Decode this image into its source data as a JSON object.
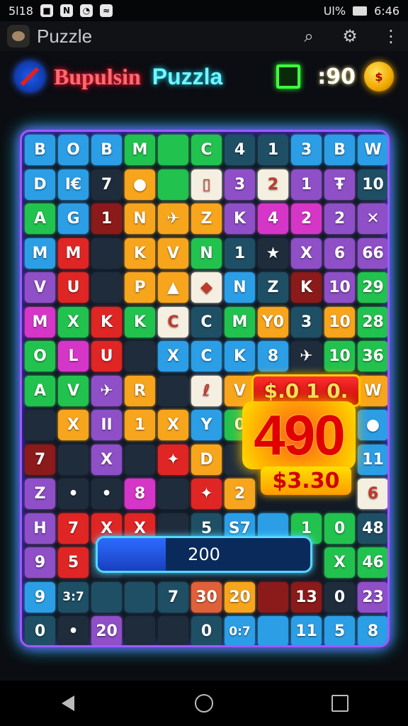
{
  "status_bar": {
    "left_text": "5l18",
    "left_icons": [
      "app-notification-icon",
      "n-notification-icon",
      "whatsapp-icon",
      "wifi-icon"
    ],
    "battery_label": "Ul%",
    "time": "6:46"
  },
  "app_bar": {
    "title": "Puzzle",
    "actions": [
      "search-icon",
      "settings-gear-icon",
      "more-vert-icon"
    ]
  },
  "game_header": {
    "title_part1": "Bupulsin",
    "title_part2": "Puzzla",
    "score": ":90",
    "colors": {
      "title1": "#ff6b6b",
      "title2": "#6ff7ff",
      "score_box": "#3dff3d"
    }
  },
  "board": {
    "tiles": [
      {
        "r": 0,
        "c": 0,
        "text": "B",
        "color": "#2b9ee6"
      },
      {
        "r": 0,
        "c": 1,
        "text": "O",
        "color": "#2b9ee6"
      },
      {
        "r": 0,
        "c": 2,
        "text": "B",
        "color": "#2b9ee6"
      },
      {
        "r": 0,
        "c": 3,
        "text": "M",
        "color": "#22c24e"
      },
      {
        "r": 0,
        "c": 4,
        "text": "",
        "color": "#22c24e"
      },
      {
        "r": 0,
        "c": 5,
        "text": "C",
        "color": "#22c24e"
      },
      {
        "r": 0,
        "c": 6,
        "text": "4",
        "color": "#1f4f64"
      },
      {
        "r": 0,
        "c": 7,
        "text": "1",
        "color": "#1f4f64"
      },
      {
        "r": 0,
        "c": 8,
        "text": "3",
        "color": "#2b9ee6"
      },
      {
        "r": 0,
        "c": 9,
        "text": "B",
        "color": "#2b9ee6"
      },
      {
        "r": 0,
        "c": 10,
        "text": "W",
        "color": "#2b9ee6"
      },
      {
        "r": 1,
        "c": 0,
        "text": "D",
        "color": "#2b9ee6"
      },
      {
        "r": 1,
        "c": 1,
        "text": "I€",
        "color": "#2b9ee6"
      },
      {
        "r": 1,
        "c": 2,
        "text": "7",
        "color": "#1f2c3c"
      },
      {
        "r": 1,
        "c": 3,
        "text": "●",
        "color": "#f7a51c"
      },
      {
        "r": 1,
        "c": 4,
        "text": "",
        "color": "#22c24e"
      },
      {
        "r": 1,
        "c": 5,
        "text": "▯",
        "color": "#f4efe0"
      },
      {
        "r": 1,
        "c": 6,
        "text": "3",
        "color": "#8e4fc7"
      },
      {
        "r": 1,
        "c": 7,
        "text": "2",
        "color": "#f4efe0"
      },
      {
        "r": 1,
        "c": 8,
        "text": "1",
        "color": "#8e4fc7"
      },
      {
        "r": 1,
        "c": 9,
        "text": "Ŧ",
        "color": "#8e4fc7"
      },
      {
        "r": 1,
        "c": 10,
        "text": "10",
        "color": "#1f4f64"
      },
      {
        "r": 2,
        "c": 0,
        "text": "A",
        "color": "#22c24e"
      },
      {
        "r": 2,
        "c": 1,
        "text": "G",
        "color": "#2b9ee6"
      },
      {
        "r": 2,
        "c": 2,
        "text": "1",
        "color": "#8b1a1a"
      },
      {
        "r": 2,
        "c": 3,
        "text": "N",
        "color": "#f7a51c"
      },
      {
        "r": 2,
        "c": 4,
        "text": "✈",
        "color": "#f7a51c"
      },
      {
        "r": 2,
        "c": 5,
        "text": "Z",
        "color": "#f7a51c"
      },
      {
        "r": 2,
        "c": 6,
        "text": "K",
        "color": "#8e4fc7"
      },
      {
        "r": 2,
        "c": 7,
        "text": "4",
        "color": "#d536c8"
      },
      {
        "r": 2,
        "c": 8,
        "text": "2",
        "color": "#d536c8"
      },
      {
        "r": 2,
        "c": 9,
        "text": "2",
        "color": "#8e4fc7"
      },
      {
        "r": 2,
        "c": 10,
        "text": "✕",
        "color": "#8e4fc7"
      },
      {
        "r": 3,
        "c": 0,
        "text": "M",
        "color": "#2b9ee6"
      },
      {
        "r": 3,
        "c": 1,
        "text": "M",
        "color": "#e02525"
      },
      {
        "r": 3,
        "c": 2,
        "text": "",
        "color": "#1f2c3c"
      },
      {
        "r": 3,
        "c": 3,
        "text": "K",
        "color": "#f7a51c"
      },
      {
        "r": 3,
        "c": 4,
        "text": "V",
        "color": "#f7a51c"
      },
      {
        "r": 3,
        "c": 5,
        "text": "N",
        "color": "#22c24e"
      },
      {
        "r": 3,
        "c": 6,
        "text": "1",
        "color": "#1f4f64"
      },
      {
        "r": 3,
        "c": 7,
        "text": "★",
        "color": "#1f2c3c"
      },
      {
        "r": 3,
        "c": 8,
        "text": "X",
        "color": "#8e4fc7"
      },
      {
        "r": 3,
        "c": 9,
        "text": "6",
        "color": "#8e4fc7"
      },
      {
        "r": 3,
        "c": 10,
        "text": "66",
        "color": "#8e4fc7"
      },
      {
        "r": 4,
        "c": 0,
        "text": "V",
        "color": "#8e4fc7"
      },
      {
        "r": 4,
        "c": 1,
        "text": "U",
        "color": "#e02525"
      },
      {
        "r": 4,
        "c": 2,
        "text": "",
        "color": "#1f2c3c"
      },
      {
        "r": 4,
        "c": 3,
        "text": "P",
        "color": "#f7a51c"
      },
      {
        "r": 4,
        "c": 4,
        "text": "▲",
        "color": "#f7a51c"
      },
      {
        "r": 4,
        "c": 5,
        "text": "◆",
        "color": "#f4efe0"
      },
      {
        "r": 4,
        "c": 6,
        "text": "N",
        "color": "#2b9ee6"
      },
      {
        "r": 4,
        "c": 7,
        "text": "Z",
        "color": "#1f4f64"
      },
      {
        "r": 4,
        "c": 8,
        "text": "K",
        "color": "#8b1a1a"
      },
      {
        "r": 4,
        "c": 9,
        "text": "10",
        "color": "#8e4fc7"
      },
      {
        "r": 4,
        "c": 10,
        "text": "29",
        "color": "#22c24e"
      },
      {
        "r": 5,
        "c": 0,
        "text": "M",
        "color": "#d536c8"
      },
      {
        "r": 5,
        "c": 1,
        "text": "X",
        "color": "#22c24e"
      },
      {
        "r": 5,
        "c": 2,
        "text": "K",
        "color": "#e02525"
      },
      {
        "r": 5,
        "c": 3,
        "text": "K",
        "color": "#22c24e"
      },
      {
        "r": 5,
        "c": 4,
        "text": "C",
        "color": "#f4efe0"
      },
      {
        "r": 5,
        "c": 5,
        "text": "C",
        "color": "#1f4f64"
      },
      {
        "r": 5,
        "c": 6,
        "text": "M",
        "color": "#22c24e"
      },
      {
        "r": 5,
        "c": 7,
        "text": "Y0",
        "color": "#f7a51c"
      },
      {
        "r": 5,
        "c": 8,
        "text": "3",
        "color": "#1f4f64"
      },
      {
        "r": 5,
        "c": 9,
        "text": "10",
        "color": "#f7a51c"
      },
      {
        "r": 5,
        "c": 10,
        "text": "28",
        "color": "#22c24e"
      },
      {
        "r": 6,
        "c": 0,
        "text": "O",
        "color": "#22c24e"
      },
      {
        "r": 6,
        "c": 1,
        "text": "L",
        "color": "#d536c8"
      },
      {
        "r": 6,
        "c": 2,
        "text": "U",
        "color": "#e02525"
      },
      {
        "r": 6,
        "c": 3,
        "text": "",
        "color": "#1f2c3c"
      },
      {
        "r": 6,
        "c": 4,
        "text": "X",
        "color": "#2b9ee6"
      },
      {
        "r": 6,
        "c": 5,
        "text": "C",
        "color": "#2b9ee6"
      },
      {
        "r": 6,
        "c": 6,
        "text": "K",
        "color": "#2b9ee6"
      },
      {
        "r": 6,
        "c": 7,
        "text": "8",
        "color": "#2b9ee6"
      },
      {
        "r": 6,
        "c": 8,
        "text": "✈",
        "color": "#1f2c3c"
      },
      {
        "r": 6,
        "c": 9,
        "text": "10",
        "color": "#22c24e"
      },
      {
        "r": 6,
        "c": 10,
        "text": "36",
        "color": "#22c24e"
      },
      {
        "r": 7,
        "c": 0,
        "text": "A",
        "color": "#22c24e"
      },
      {
        "r": 7,
        "c": 1,
        "text": "V",
        "color": "#22c24e"
      },
      {
        "r": 7,
        "c": 2,
        "text": "✈",
        "color": "#8e4fc7"
      },
      {
        "r": 7,
        "c": 3,
        "text": "R",
        "color": "#f7a51c"
      },
      {
        "r": 7,
        "c": 4,
        "text": "",
        "color": "#1f2c3c"
      },
      {
        "r": 7,
        "c": 5,
        "text": "ℓ",
        "color": "#f4efe0"
      },
      {
        "r": 7,
        "c": 6,
        "text": "V",
        "color": "#f7a51c"
      },
      {
        "r": 7,
        "c": 10,
        "text": "W",
        "color": "#f7a51c"
      },
      {
        "r": 8,
        "c": 0,
        "text": "",
        "color": "#1f2c3c"
      },
      {
        "r": 8,
        "c": 1,
        "text": "X",
        "color": "#f7a51c"
      },
      {
        "r": 8,
        "c": 2,
        "text": "II",
        "color": "#8e4fc7"
      },
      {
        "r": 8,
        "c": 3,
        "text": "1",
        "color": "#f7a51c"
      },
      {
        "r": 8,
        "c": 4,
        "text": "X",
        "color": "#f7a51c"
      },
      {
        "r": 8,
        "c": 5,
        "text": "Y",
        "color": "#2b9ee6"
      },
      {
        "r": 8,
        "c": 6,
        "text": "0",
        "color": "#22c24e"
      },
      {
        "r": 8,
        "c": 10,
        "text": "●",
        "color": "#2b9ee6"
      },
      {
        "r": 9,
        "c": 0,
        "text": "7",
        "color": "#8b1a1a"
      },
      {
        "r": 9,
        "c": 1,
        "text": "",
        "color": "#1f2c3c"
      },
      {
        "r": 9,
        "c": 2,
        "text": "X",
        "color": "#8e4fc7"
      },
      {
        "r": 9,
        "c": 3,
        "text": "",
        "color": "#1f2c3c"
      },
      {
        "r": 9,
        "c": 4,
        "text": "✦",
        "color": "#e02525"
      },
      {
        "r": 9,
        "c": 5,
        "text": "D",
        "color": "#f7a51c"
      },
      {
        "r": 9,
        "c": 6,
        "text": "",
        "color": "#1f2c3c"
      },
      {
        "r": 9,
        "c": 10,
        "text": "11",
        "color": "#2b9ee6"
      },
      {
        "r": 10,
        "c": 0,
        "text": "Z",
        "color": "#8e4fc7"
      },
      {
        "r": 10,
        "c": 1,
        "text": "•",
        "color": "#1f2c3c"
      },
      {
        "r": 10,
        "c": 2,
        "text": "•",
        "color": "#1f2c3c"
      },
      {
        "r": 10,
        "c": 3,
        "text": "8",
        "color": "#d536c8"
      },
      {
        "r": 10,
        "c": 4,
        "text": "",
        "color": "#1f2c3c"
      },
      {
        "r": 10,
        "c": 5,
        "text": "✦",
        "color": "#e02525"
      },
      {
        "r": 10,
        "c": 6,
        "text": "2",
        "color": "#f7a51c"
      },
      {
        "r": 10,
        "c": 10,
        "text": "6",
        "color": "#f4efe0"
      },
      {
        "r": 11,
        "c": 0,
        "text": "H",
        "color": "#8e4fc7"
      },
      {
        "r": 11,
        "c": 1,
        "text": "7",
        "color": "#e02525"
      },
      {
        "r": 11,
        "c": 2,
        "text": "X",
        "color": "#e02525"
      },
      {
        "r": 11,
        "c": 3,
        "text": "X",
        "color": "#e02525"
      },
      {
        "r": 11,
        "c": 4,
        "text": "",
        "color": "#1f2c3c"
      },
      {
        "r": 11,
        "c": 5,
        "text": "5",
        "color": "#1f4f64"
      },
      {
        "r": 11,
        "c": 6,
        "text": "S7",
        "color": "#2b9ee6"
      },
      {
        "r": 11,
        "c": 7,
        "text": "",
        "color": "#2b9ee6"
      },
      {
        "r": 11,
        "c": 8,
        "text": "1",
        "color": "#22c24e"
      },
      {
        "r": 11,
        "c": 9,
        "text": "0",
        "color": "#22c24e"
      },
      {
        "r": 11,
        "c": 10,
        "text": "48",
        "color": "#1f4f64"
      },
      {
        "r": 12,
        "c": 0,
        "text": "9",
        "color": "#8e4fc7"
      },
      {
        "r": 12,
        "c": 1,
        "text": "5",
        "color": "#e02525"
      },
      {
        "r": 12,
        "c": 2,
        "text": "",
        "color": "#1f2c3c"
      },
      {
        "r": 12,
        "c": 9,
        "text": "X",
        "color": "#22c24e"
      },
      {
        "r": 12,
        "c": 10,
        "text": "46",
        "color": "#22c24e"
      },
      {
        "r": 13,
        "c": 0,
        "text": "9",
        "color": "#2b9ee6"
      },
      {
        "r": 13,
        "c": 1,
        "text": "3:7",
        "color": "#1f4f64"
      },
      {
        "r": 13,
        "c": 2,
        "text": "",
        "color": "#1f4f64"
      },
      {
        "r": 13,
        "c": 3,
        "text": "",
        "color": "#1f4f64"
      },
      {
        "r": 13,
        "c": 4,
        "text": "7",
        "color": "#1f4f64"
      },
      {
        "r": 13,
        "c": 5,
        "text": "30",
        "color": "#e0603a"
      },
      {
        "r": 13,
        "c": 6,
        "text": "20",
        "color": "#f7a51c"
      },
      {
        "r": 13,
        "c": 7,
        "text": "",
        "color": "#8b1a1a"
      },
      {
        "r": 13,
        "c": 8,
        "text": "13",
        "color": "#8b1a1a"
      },
      {
        "r": 13,
        "c": 9,
        "text": "0",
        "color": "#1f2c3c"
      },
      {
        "r": 13,
        "c": 10,
        "text": "23",
        "color": "#8e4fc7"
      },
      {
        "r": 14,
        "c": 0,
        "text": "0",
        "color": "#1f4f64"
      },
      {
        "r": 14,
        "c": 1,
        "text": "•",
        "color": "#1f2c3c"
      },
      {
        "r": 14,
        "c": 2,
        "text": "20",
        "color": "#8e4fc7"
      },
      {
        "r": 14,
        "c": 3,
        "text": "",
        "color": "#1f2c3c"
      },
      {
        "r": 14,
        "c": 4,
        "text": "",
        "color": "#1f2c3c"
      },
      {
        "r": 14,
        "c": 5,
        "text": "0",
        "color": "#1f4f64"
      },
      {
        "r": 14,
        "c": 6,
        "text": "0:7",
        "color": "#2b9ee6"
      },
      {
        "r": 14,
        "c": 7,
        "text": "",
        "color": "#2b9ee6"
      },
      {
        "r": 14,
        "c": 8,
        "text": "11",
        "color": "#2b9ee6"
      },
      {
        "r": 14,
        "c": 9,
        "text": "5",
        "color": "#2b9ee6"
      },
      {
        "r": 14,
        "c": 10,
        "text": "8",
        "color": "#2b9ee6"
      }
    ]
  },
  "reward_popup": {
    "top_label": "$.0 1 0.",
    "big_value": "490",
    "bottom_label": "$3.30"
  },
  "progress_bar": {
    "label": "200",
    "fill_fraction": 0.32,
    "fill_color": "#2c6cff"
  },
  "nav_bar": {
    "buttons": [
      "back-icon",
      "home-icon",
      "recent-apps-icon"
    ]
  }
}
